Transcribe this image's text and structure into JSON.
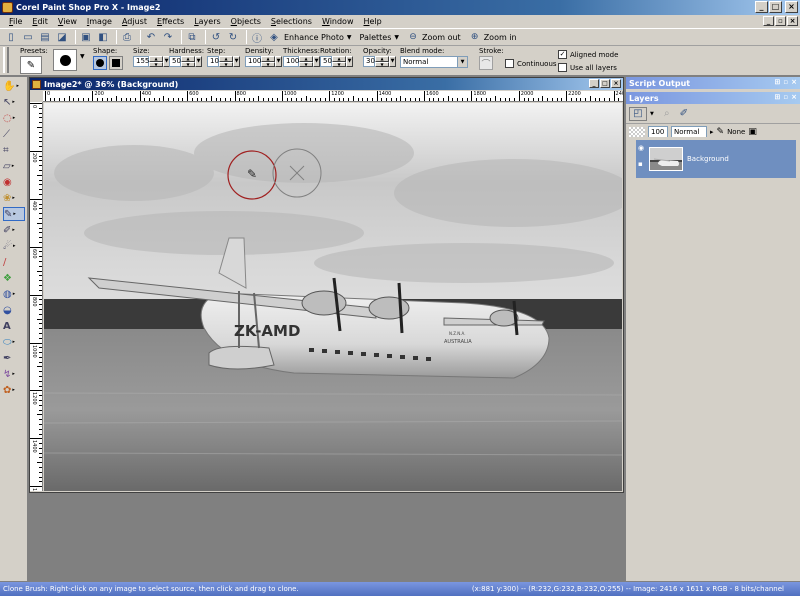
{
  "window": {
    "title": "Corel Paint Shop Pro X - Image2"
  },
  "menu": [
    "File",
    "Edit",
    "View",
    "Image",
    "Adjust",
    "Effects",
    "Layers",
    "Objects",
    "Selections",
    "Window",
    "Help"
  ],
  "toolbar": {
    "enhance_photo": "Enhance Photo",
    "palettes": "Palettes",
    "zoom_out": "Zoom out",
    "zoom_in": "Zoom in"
  },
  "tool_options": {
    "presets_label": "Presets:",
    "shape_label": "Shape:",
    "size_label": "Size:",
    "size_value": "155",
    "hardness_label": "Hardness:",
    "hardness_value": "50",
    "step_label": "Step:",
    "step_value": "10",
    "density_label": "Density:",
    "density_value": "100",
    "thickness_label": "Thickness:",
    "thickness_value": "100",
    "rotation_label": "Rotation:",
    "rotation_value": "50",
    "opacity_label": "Opacity:",
    "opacity_value": "30",
    "blend_mode_label": "Blend mode:",
    "blend_mode_value": "Normal",
    "stroke_label": "Stroke:",
    "continuous_label": "Continuous",
    "aligned_mode_label": "Aligned mode",
    "aligned_mode_checked": true,
    "use_all_layers_label": "Use all layers",
    "continuous_checked": false,
    "use_all_layers_checked": false
  },
  "document": {
    "title": "Image2* @ 36% (Background)",
    "ruler_h": [
      "0",
      "200",
      "400",
      "600",
      "800",
      "1000",
      "1200",
      "1400",
      "1600",
      "1800",
      "2000",
      "2200",
      "2400"
    ],
    "ruler_v": [
      "0",
      "200",
      "400",
      "600",
      "800",
      "1000",
      "1200",
      "1400",
      "1600"
    ],
    "photo_text": {
      "registration": "ZK-AMD",
      "airline_small": "N.Z.N.A.",
      "airline": "AUSTRALIA"
    }
  },
  "script_output": {
    "title": "Script Output"
  },
  "layers": {
    "title": "Layers",
    "opacity": "100",
    "blend": "Normal",
    "mask": "None",
    "items": [
      {
        "name": "Background"
      }
    ]
  },
  "status": {
    "hint": "Clone Brush: Right-click on any image to select source, then click and drag to clone.",
    "info": "(x:881 y:300) -- (R:232,G:232,B:232,O:255) -- Image:  2416 x 1611 x RGB - 8 bits/channel"
  },
  "colors": {
    "title_bar": "#0a246a",
    "palette_bar": "#7a96df",
    "selected_layer": "#6f8fc0",
    "status_bar": "#5070c0"
  }
}
